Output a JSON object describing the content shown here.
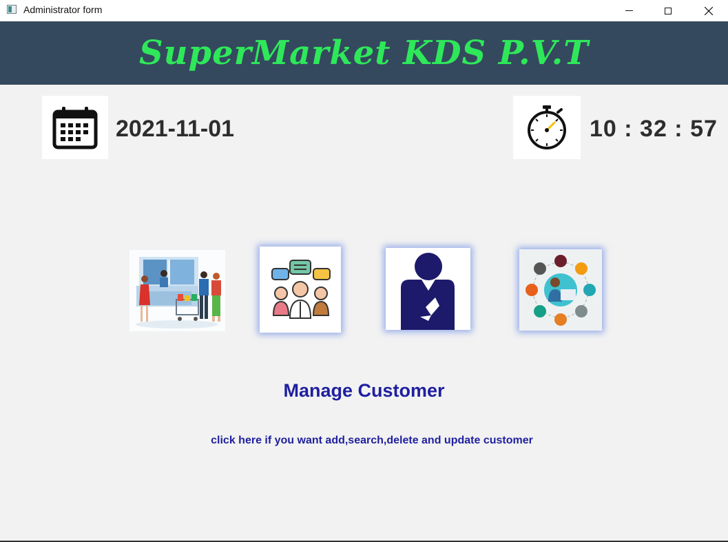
{
  "window": {
    "title": "Administrator form"
  },
  "header": {
    "brand": "SuperMarket KDS P.V.T",
    "brand_color": "#2ee85a",
    "background": "#34495e"
  },
  "status": {
    "date": "2021-11-01",
    "time": "10 : 32 : 57",
    "date_icon": "calendar-icon",
    "time_icon": "stopwatch-icon"
  },
  "features": [
    {
      "name": "supermarket-shoppers",
      "icon": "shoppers-illustration-icon"
    },
    {
      "name": "manage-customer",
      "icon": "customers-group-icon"
    },
    {
      "name": "manage-employee",
      "icon": "user-silhouette-icon"
    },
    {
      "name": "business-network",
      "icon": "business-network-icon"
    }
  ],
  "selected_feature": {
    "heading": "Manage Customer",
    "description": "click here if you want add,search,delete and update customer"
  }
}
